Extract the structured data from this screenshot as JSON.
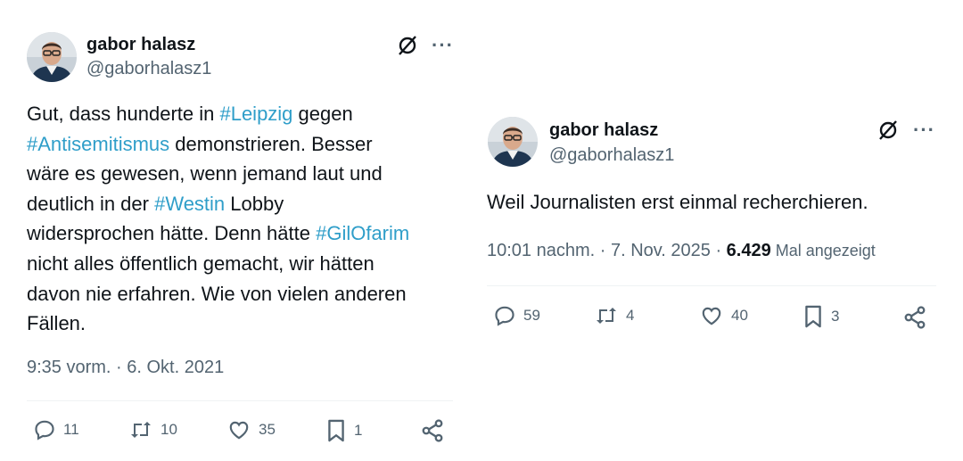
{
  "tweets": [
    {
      "author": {
        "name": "gabor halasz",
        "handle": "@gaborhalasz1"
      },
      "text_lines": [
        [
          {
            "t": "Gut, dass hunderte in "
          },
          {
            "t": "#Leipzig",
            "tag": true
          },
          {
            "t": " gegen"
          }
        ],
        [
          {
            "t": "#Antisemitismus",
            "tag": true
          },
          {
            "t": " demonstrieren. Besser"
          }
        ],
        [
          {
            "t": "wäre es gewesen, wenn jemand laut und"
          }
        ],
        [
          {
            "t": "deutlich in der "
          },
          {
            "t": "#Westin",
            "tag": true
          },
          {
            "t": " Lobby"
          }
        ],
        [
          {
            "t": "widersprochen hätte. Denn hätte "
          },
          {
            "t": "#GilOfarim",
            "tag": true
          }
        ],
        [
          {
            "t": "nicht alles öffentlich gemacht, wir hätten"
          }
        ],
        [
          {
            "t": "davon nie erfahren. Wie von vielen anderen"
          }
        ],
        [
          {
            "t": "Fällen."
          }
        ]
      ],
      "timestamp": "9:35 vorm. · 6. Okt. 2021",
      "actions": {
        "replies": "11",
        "reposts": "10",
        "likes": "35",
        "bookmarks": "1"
      }
    },
    {
      "author": {
        "name": "gabor halasz",
        "handle": "@gaborhalasz1"
      },
      "text_lines": [
        [
          {
            "t": "Weil Journalisten erst einmal recherchieren."
          }
        ]
      ],
      "timestamp": "10:01 nachm. · 7. Nov. 2025 · ",
      "views_count": "6.429",
      "views_label": " Mal angezeigt",
      "actions": {
        "replies": "59",
        "reposts": "4",
        "likes": "40",
        "bookmarks": "3"
      }
    }
  ],
  "colors": {
    "hashtag": "#2f9ec9",
    "secondary_text": "#536471",
    "primary_text": "#0f1419"
  },
  "icons": [
    "grok-icon",
    "more-icon",
    "reply-icon",
    "repost-icon",
    "like-icon",
    "bookmark-icon",
    "share-icon"
  ]
}
